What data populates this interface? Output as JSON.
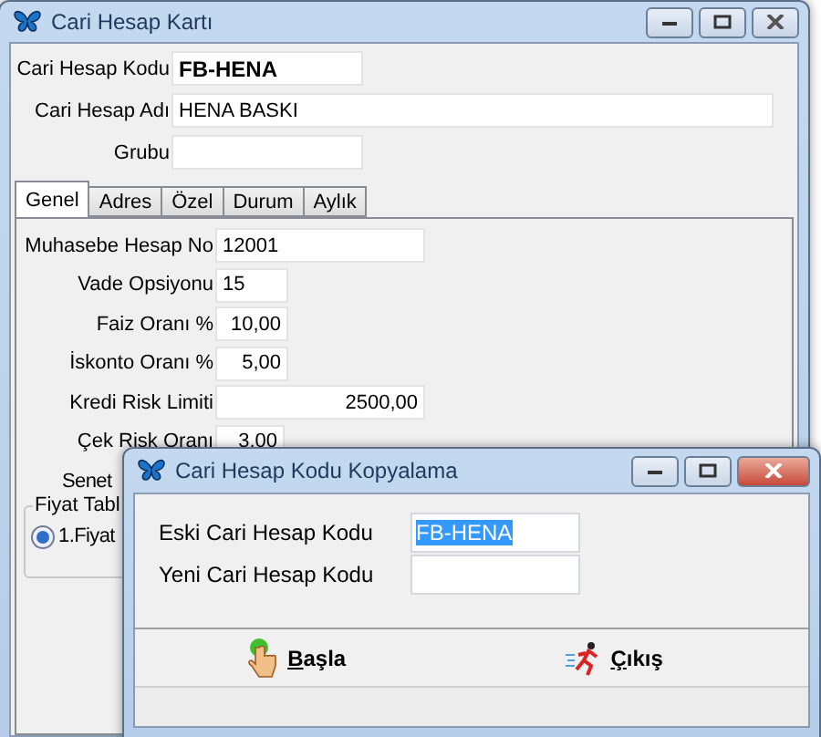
{
  "main_window": {
    "title": "Cari Hesap Kartı",
    "header_fields": [
      {
        "label": "Cari Hesap Kodu",
        "value": "FB-HENA",
        "bold": true
      },
      {
        "label": "Cari Hesap Adı",
        "value": "HENA BASKI",
        "bold": false
      },
      {
        "label": "Grubu"
      }
    ],
    "tabs": [
      {
        "label": "Genel",
        "selected": true
      },
      {
        "label": "Adres",
        "selected": false
      },
      {
        "label": "Özel",
        "selected": false
      },
      {
        "label": "Durum",
        "selected": false
      },
      {
        "label": "Aylık",
        "selected": false
      }
    ],
    "fields": [
      {
        "kind": "text",
        "label": "Muhasebe Hesap No",
        "value": "12001"
      },
      {
        "kind": "text",
        "label": "Vade Opsiyonu",
        "value": "15"
      },
      {
        "kind": "number",
        "label": "Faiz Oranı %",
        "value": "10,00"
      },
      {
        "kind": "number",
        "label": "İskonto Oranı %",
        "value": "5,00"
      },
      {
        "kind": "number",
        "label": "Kredi Risk Limiti",
        "value": "2500,00"
      },
      {
        "kind": "number",
        "label": "Çek Risk Oranı",
        "value": "3,00"
      },
      {
        "kind": "cut",
        "label": "Senet"
      }
    ],
    "price_group": {
      "title": "Fiyat Tabl",
      "options": [
        {
          "label": "1.Fiyat",
          "selected": true
        }
      ]
    }
  },
  "dialog": {
    "title": "Cari Hesap Kodu Kopyalama",
    "fields": [
      {
        "label": "Eski Cari Hesap Kodu",
        "value": "FB-HENA",
        "selected": true
      },
      {
        "label": "Yeni Cari Hesap Kodu"
      }
    ],
    "buttons": [
      {
        "kind": "start",
        "label": "Başla"
      },
      {
        "kind": "exit",
        "label": "Çıkış"
      }
    ]
  }
}
